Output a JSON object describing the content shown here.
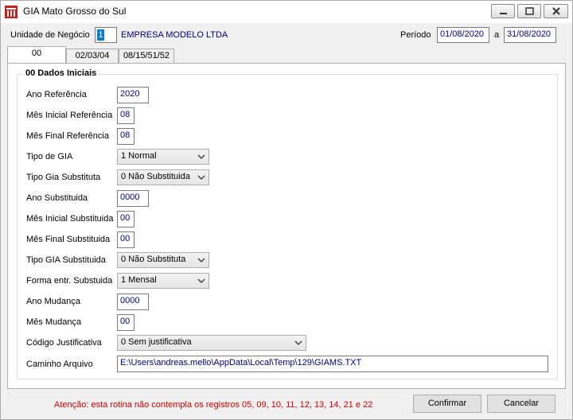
{
  "window": {
    "title": "GIA Mato Grosso do Sul"
  },
  "header": {
    "unidade_label": "Unidade de Negócio",
    "unidade_code": "1",
    "company_name": "EMPRESA MODELO LTDA",
    "periodo_label": "Período",
    "periodo_start": "01/08/2020",
    "periodo_sep": "a",
    "periodo_end": "31/08/2020"
  },
  "tabs": [
    {
      "label": "00",
      "active": true
    },
    {
      "label": "02/03/04",
      "active": false
    },
    {
      "label": "08/15/51/52",
      "active": false
    }
  ],
  "group": {
    "title": "00 Dados Iniciais"
  },
  "fields": {
    "ano_referencia": {
      "label": "Ano Referência",
      "value": "2020"
    },
    "mes_inicial_referencia": {
      "label": "Mês Inicial Referência",
      "value": "08"
    },
    "mes_final_referencia": {
      "label": "Mês Final Referência",
      "value": "08"
    },
    "tipo_gia": {
      "label": "Tipo de GIA",
      "value": "1 Normal"
    },
    "tipo_gia_substituta": {
      "label": "Tipo Gia Substituta",
      "value": "0 Não Substituida"
    },
    "ano_substituida": {
      "label": "Ano Substituida",
      "value": "0000"
    },
    "mes_inicial_substituida": {
      "label": "Mês Inicial Substituida",
      "value": "00"
    },
    "mes_final_substituida": {
      "label": "Mês Final Substituida",
      "value": "00"
    },
    "tipo_gia_substituida": {
      "label": "Tipo GIA Substituida",
      "value": "0 Não Substituta"
    },
    "forma_entr_substuida": {
      "label": "Forma entr. Substuida",
      "value": "1 Mensal"
    },
    "ano_mudanca": {
      "label": "Ano Mudança",
      "value": "0000"
    },
    "mes_mudanca": {
      "label": "Mês Mudança",
      "value": "00"
    },
    "codigo_justificativa": {
      "label": "Código Justificativa",
      "value": "0 Sem justificativa"
    },
    "caminho_arquivo": {
      "label": "Caminho Arquivo",
      "value": "E:\\Users\\andreas.mello\\AppData\\Local\\Temp\\129\\GIAMS.TXT"
    }
  },
  "footer": {
    "warning": "Atenção: esta rotina não contempla os registros 05, 09, 10, 11, 12, 13, 14, 21 e 22",
    "confirm_label": "Confirmar",
    "cancel_label": "Cancelar"
  },
  "colors": {
    "value_text": "#000080",
    "warning": "#cc0000",
    "selection": "#0078d7"
  }
}
